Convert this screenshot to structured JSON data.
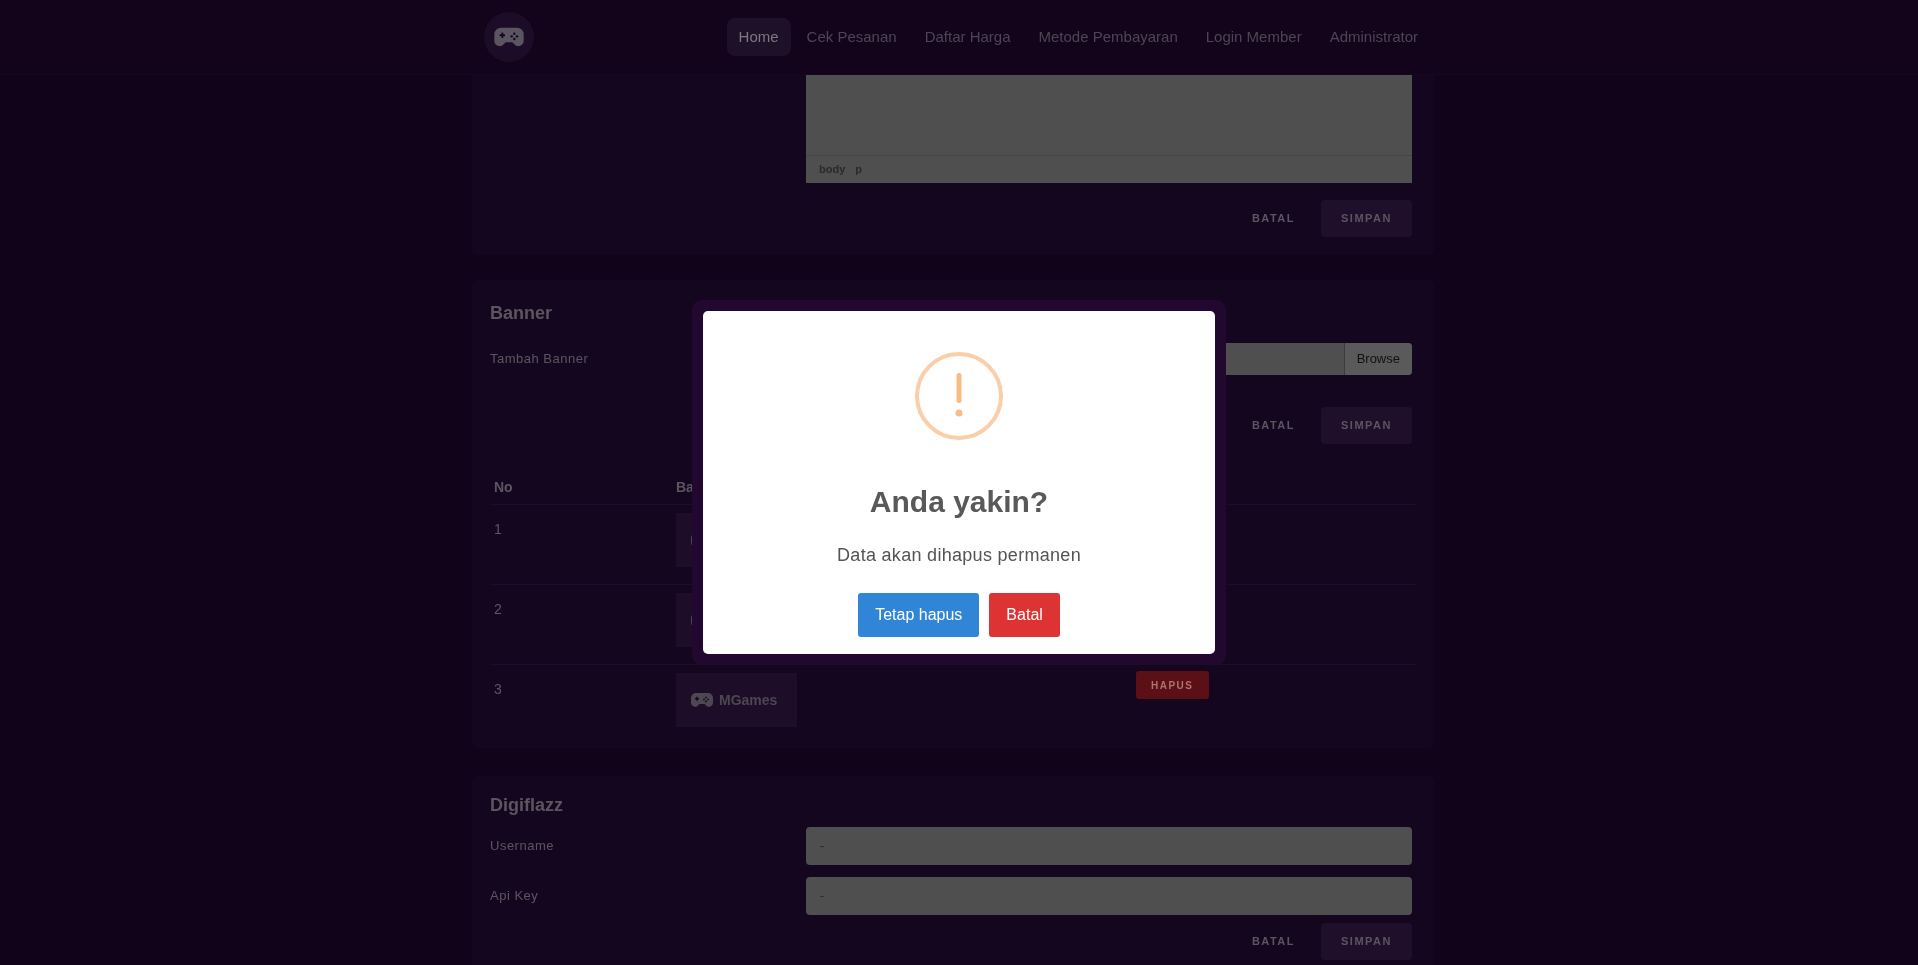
{
  "nav": {
    "items": [
      {
        "label": "Home",
        "selected": true
      },
      {
        "label": "Cek Pesanan",
        "selected": false
      },
      {
        "label": "Daftar Harga",
        "selected": false
      },
      {
        "label": "Metode Pembayaran",
        "selected": false
      },
      {
        "label": "Login Member",
        "selected": false
      },
      {
        "label": "Administrator",
        "selected": false
      }
    ]
  },
  "editor_card": {
    "status_path": [
      "body",
      "p"
    ],
    "buttons": [
      {
        "label": "BATAL",
        "kind": "text"
      },
      {
        "label": "SIMPAN",
        "kind": "filled"
      }
    ]
  },
  "banner_card": {
    "title": "Banner",
    "upload": {
      "label": "Tambah Banner",
      "button": "Browse"
    },
    "buttons": [
      {
        "label": "BATAL",
        "kind": "text"
      },
      {
        "label": "SIMPAN",
        "kind": "filled"
      }
    ],
    "table": {
      "columns": [
        "No",
        "Ba"
      ],
      "rows": [
        {
          "no": "1"
        },
        {
          "no": "2"
        },
        {
          "no": "3",
          "logo_text": "MGames",
          "action": "HAPUS"
        }
      ]
    }
  },
  "digiflazz_card": {
    "title": "Digiflazz",
    "fields": [
      {
        "label": "Username",
        "value": "-"
      },
      {
        "label": "Api Key",
        "value": "-"
      }
    ],
    "buttons": [
      {
        "label": "BATAL",
        "kind": "text"
      },
      {
        "label": "SIMPAN",
        "kind": "filled"
      }
    ]
  },
  "dialog": {
    "title": "Anda yakin?",
    "message": "Data akan dihapus permanen",
    "buttons": [
      {
        "label": "Tetap hapus",
        "kind": "confirm"
      },
      {
        "label": "Batal",
        "kind": "cancel"
      }
    ]
  }
}
